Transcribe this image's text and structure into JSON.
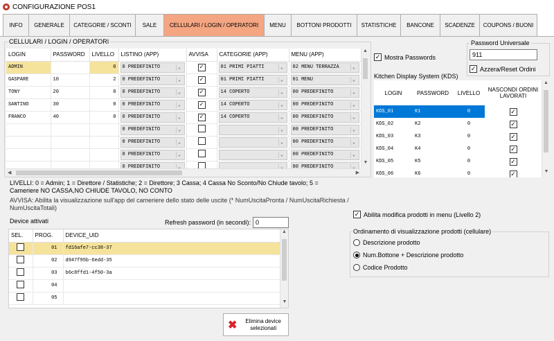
{
  "window": {
    "title": "CONFIGURAZIONE POS1"
  },
  "tabs": [
    {
      "label": "INFO"
    },
    {
      "label": "GENERALE"
    },
    {
      "label": "CATEGORIE / SCONTI"
    },
    {
      "label": "SALE"
    },
    {
      "label": "CELLULARI / LOGIN / OPERATORI"
    },
    {
      "label": "MENU"
    },
    {
      "label": "BOTTONI PRODOTTI"
    },
    {
      "label": "STATISTICHE"
    },
    {
      "label": "BANCONE"
    },
    {
      "label": "SCADENZE"
    },
    {
      "label": "COUPONS / BUONI"
    }
  ],
  "operators": {
    "group_label": "CELLULARI / LOGIN / OPERATORI",
    "columns": [
      "LOGIN",
      "PASSWORD",
      "LIVELLO",
      "LISTINO (APP)",
      "AVVISA",
      "CATEGORIE (APP)",
      "MENU (APP)"
    ],
    "rows": [
      {
        "login": "ADMIN",
        "password": "",
        "livello": "0",
        "listino": "0 PREDEFINITO",
        "avvisa": true,
        "categorie": "01 PRIMI PIATTI",
        "menu": "02 MENU TERRAZZA"
      },
      {
        "login": "GASPARE",
        "password": "10",
        "livello": "2",
        "listino": "0 PREDEFINITO",
        "avvisa": true,
        "categorie": "01 PRIMI PIATTI",
        "menu": "01 MENU"
      },
      {
        "login": "TONY",
        "password": "20",
        "livello": "0",
        "listino": "0 PREDEFINITO",
        "avvisa": true,
        "categorie": "14 COPERTO",
        "menu": "00 PREDEFINITO"
      },
      {
        "login": "SANTINO",
        "password": "30",
        "livello": "0",
        "listino": "0 PREDEFINITO",
        "avvisa": true,
        "categorie": "14 COPERTO",
        "menu": "00 PREDEFINITO"
      },
      {
        "login": "FRANCO",
        "password": "40",
        "livello": "0",
        "listino": "0 PREDEFINITO",
        "avvisa": true,
        "categorie": "14 COPERTO",
        "menu": "00 PREDEFINITO"
      },
      {
        "login": "",
        "password": "",
        "livello": "",
        "listino": "0 PREDEFINITO",
        "avvisa": false,
        "categorie": "",
        "menu": "00 PREDEFINITO"
      },
      {
        "login": "",
        "password": "",
        "livello": "",
        "listino": "0 PREDEFINITO",
        "avvisa": false,
        "categorie": "",
        "menu": "00 PREDEFINITO"
      },
      {
        "login": "",
        "password": "",
        "livello": "",
        "listino": "0 PREDEFINITO",
        "avvisa": false,
        "categorie": "",
        "menu": "00 PREDEFINITO"
      },
      {
        "login": "",
        "password": "",
        "livello": "",
        "listino": "0 PREDEFINITO",
        "avvisa": false,
        "categorie": "",
        "menu": "00 PREDEFINITO"
      }
    ]
  },
  "mostra_passwords": {
    "label": "Mostra Passwords",
    "checked": true
  },
  "password_universale": {
    "label": "Password Universale",
    "value": "911",
    "reset_label": "Azzera/Reset Ordini",
    "reset_checked": true
  },
  "kds": {
    "label": "Kitchen Display System (KDS)",
    "columns": [
      "LOGIN",
      "PASSWORD",
      "LIVELLO",
      "NASCONDI ORDINI LAVORATI"
    ],
    "rows": [
      {
        "login": "KDS_01",
        "password": "K1",
        "livello": "0",
        "nascondi": true
      },
      {
        "login": "KDS_02",
        "password": "K2",
        "livello": "0",
        "nascondi": true
      },
      {
        "login": "KDS_03",
        "password": "K3",
        "livello": "0",
        "nascondi": true
      },
      {
        "login": "KDS_04",
        "password": "K4",
        "livello": "0",
        "nascondi": true
      },
      {
        "login": "KDS_05",
        "password": "K5",
        "livello": "0",
        "nascondi": true
      },
      {
        "login": "KDS_06",
        "password": "K6",
        "livello": "0",
        "nascondi": true
      }
    ]
  },
  "info": {
    "livelli": "LIVELLI: 0 = Admin; 1 = Direttore / Statistiche; 2 = Direttore; 3 Cassa; 4 Cassa No Sconto/No Chiude tavolo; 5 = Cameriere NO CASSA,NO CHIUDE TAVOLO, NO CONTO",
    "avvisa": "AVVISA: Abilita la visualizzazione sull'app del cameriere dello stato delle uscite (* NumUscitaPronta / NumUscitaRichiesta / NumUscitaTotali)"
  },
  "devices": {
    "label": "Device attivati",
    "refresh_label": "Refresh password (in secondi):",
    "refresh_value": "0",
    "columns": [
      "SEL.",
      "PROG.",
      "DEVICE_UID"
    ],
    "rows": [
      {
        "sel": false,
        "prog": "01",
        "uid": "fd16afe7-cc38-37"
      },
      {
        "sel": false,
        "prog": "02",
        "uid": "d947f95b-6edd-35"
      },
      {
        "sel": false,
        "prog": "03",
        "uid": "b6c8ffd1-4f50-3a"
      },
      {
        "sel": false,
        "prog": "04",
        "uid": ""
      },
      {
        "sel": false,
        "prog": "05",
        "uid": ""
      }
    ],
    "delete_label": "Elimina device selezionati"
  },
  "abilita_modifica": {
    "label": "Abilita modifica prodotti in menu (Livello 2)",
    "checked": true
  },
  "ordinamento": {
    "label": "Ordinamento di visualizzazione prodotti (cellulare)",
    "options": [
      "Descrizione prodotto",
      "Num.Bottone + Descrizione prodotto",
      "Codice Prodotto"
    ],
    "selected": 1
  },
  "colors": {
    "active_tab": "#f4a582",
    "selected_row": "#f5e39c",
    "kds_selected": "#0078d7"
  }
}
